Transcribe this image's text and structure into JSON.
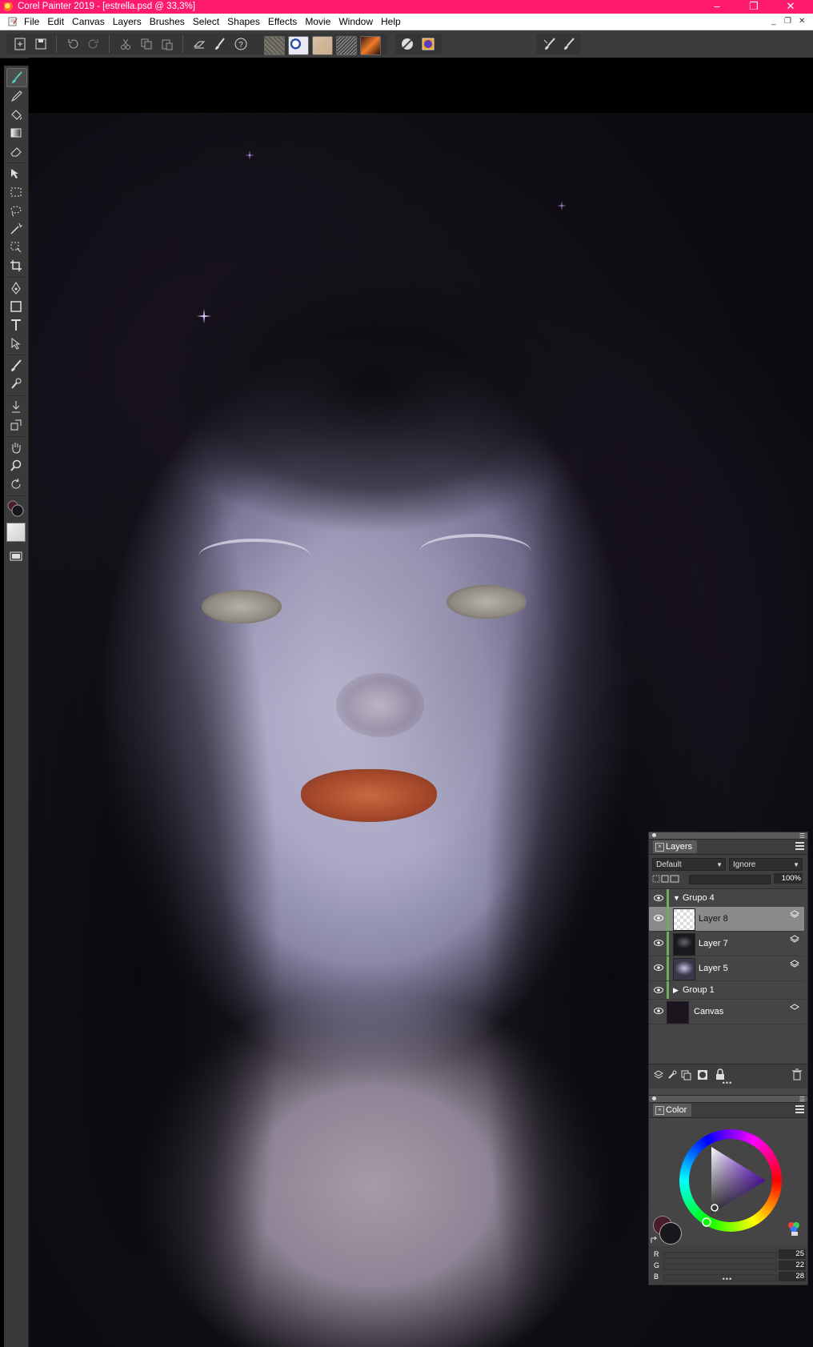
{
  "app": {
    "title": "Corel Painter 2019 - [estrella.psd @ 33,3%]"
  },
  "menu": [
    "File",
    "Edit",
    "Canvas",
    "Layers",
    "Brushes",
    "Select",
    "Shapes",
    "Effects",
    "Movie",
    "Window",
    "Help"
  ],
  "toolbar": {
    "buttons": [
      "new-document-icon",
      "save-icon",
      "undo-icon",
      "redo-icon",
      "cut-icon",
      "copy-icon",
      "paste-icon",
      "clear-icon",
      "brush-icon",
      "help-icon"
    ],
    "swatches": [
      "paper-texture",
      "pattern",
      "flow-map",
      "gradient",
      "nozzle"
    ],
    "right": [
      "brush-selector-icon",
      "color-icon",
      "brush-controls-icon",
      "brush-tracking-icon"
    ]
  },
  "tools": [
    "brush",
    "dropper",
    "paint-bucket",
    "gradient",
    "eraser",
    "layer-adjuster",
    "rectangular-selection",
    "lasso",
    "magic-wand",
    "transform",
    "crop",
    "pen",
    "rectangle",
    "text",
    "shape-selection",
    "cloner",
    "rubber-stamp",
    "dodge",
    "mirror",
    "grabber",
    "magnifier",
    "rotate-page"
  ],
  "layers_panel": {
    "tab": "Layers",
    "composite_method": "Default",
    "preserve_mode": "Ignore",
    "opacity": "100%",
    "group4": "Grupo 4",
    "layer8": "Layer 8",
    "layer7": "Layer 7",
    "layer5": "Layer 5",
    "group1": "Group 1",
    "canvas": "Canvas"
  },
  "color_panel": {
    "tab": "Color",
    "r_label": "R",
    "g_label": "G",
    "b_label": "B",
    "r": "25",
    "g": "22",
    "b": "28",
    "main_color": "#19161c",
    "additional_color": "#4a1c2a"
  }
}
